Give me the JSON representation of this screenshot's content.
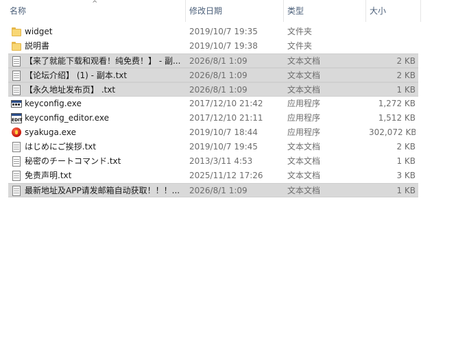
{
  "columns": {
    "name": "名称",
    "date": "修改日期",
    "type": "类型",
    "size": "大小"
  },
  "sort_indicator": "^",
  "files": [
    {
      "name": "widget",
      "date": "2019/10/7 19:35",
      "type": "文件夹",
      "size": "",
      "icon": "folder-icon",
      "selected": false
    },
    {
      "name": "説明書",
      "date": "2019/10/7 19:38",
      "type": "文件夹",
      "size": "",
      "icon": "folder-icon",
      "selected": false
    },
    {
      "name": "【来了就能下载和观看！纯免费！】 - 副...",
      "date": "2026/8/1 1:09",
      "type": "文本文档",
      "size": "2 KB",
      "icon": "text-file-icon",
      "selected": true
    },
    {
      "name": "【论坛介绍】 (1) - 副本.txt",
      "date": "2026/8/1 1:09",
      "type": "文本文档",
      "size": "2 KB",
      "icon": "text-file-icon",
      "selected": true
    },
    {
      "name": "【永久地址发布页】 .txt",
      "date": "2026/8/1 1:09",
      "type": "文本文档",
      "size": "1 KB",
      "icon": "text-file-icon",
      "selected": true
    },
    {
      "name": "keyconfig.exe",
      "date": "2017/12/10 21:42",
      "type": "应用程序",
      "size": "1,272 KB",
      "icon": "application-icon",
      "selected": false
    },
    {
      "name": "keyconfig_editor.exe",
      "date": "2017/12/10 21:11",
      "type": "应用程序",
      "size": "1,512 KB",
      "icon": "editor-app-icon",
      "selected": false
    },
    {
      "name": "syakuga.exe",
      "date": "2019/10/7 18:44",
      "type": "应用程序",
      "size": "302,072 KB",
      "icon": "game-app-icon",
      "selected": false
    },
    {
      "name": "はじめにご挨拶.txt",
      "date": "2019/10/7 19:45",
      "type": "文本文档",
      "size": "2 KB",
      "icon": "text-file-icon",
      "selected": false
    },
    {
      "name": "秘密のチートコマンド.txt",
      "date": "2013/3/11 4:53",
      "type": "文本文档",
      "size": "1 KB",
      "icon": "text-file-icon",
      "selected": false
    },
    {
      "name": "免责声明.txt",
      "date": "2025/11/12 17:26",
      "type": "文本文档",
      "size": "3 KB",
      "icon": "text-file-icon",
      "selected": false
    },
    {
      "name": "最新地址及APP请发邮箱自动获取！！！...",
      "date": "2026/8/1 1:09",
      "type": "文本文档",
      "size": "1 KB",
      "icon": "text-file-icon",
      "selected": true
    }
  ],
  "editor_icon_text": "EDIT",
  "colors": {
    "selected_row": "#d9d9d9",
    "header_text": "#4c607a",
    "folder": "#f8d775"
  }
}
